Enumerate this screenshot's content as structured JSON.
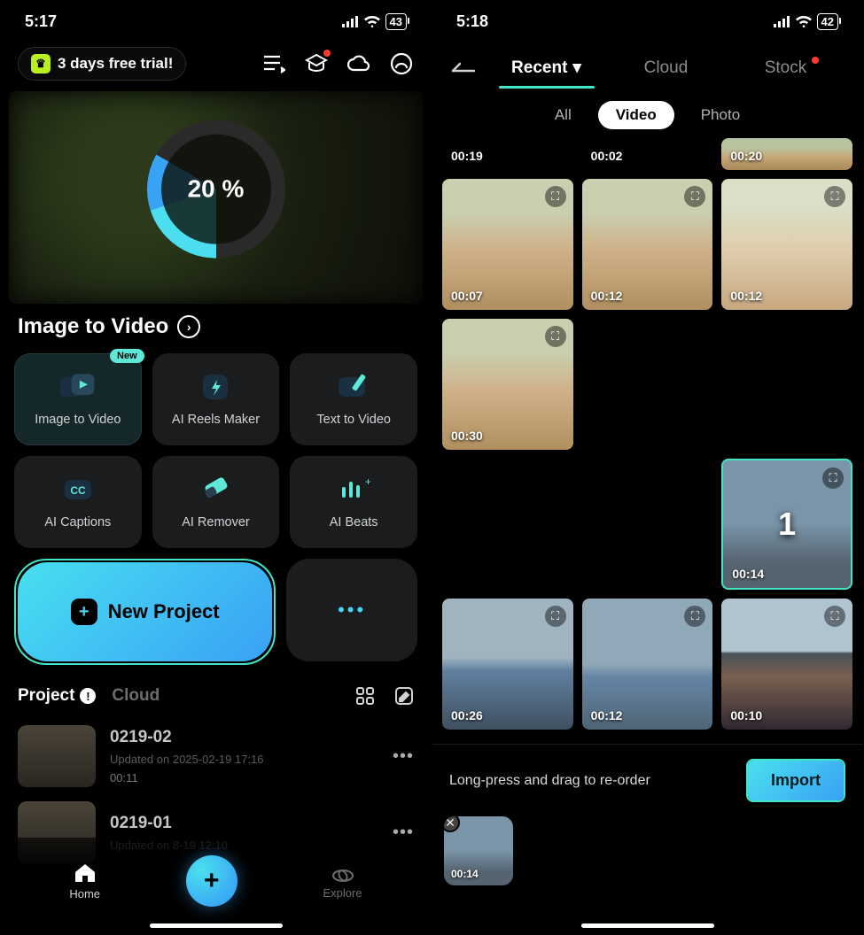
{
  "s1": {
    "status_time": "5:17",
    "battery": "43",
    "trial_text": "3 days free trial!",
    "ring_percent": "20 %",
    "feature_title": "Image to Video",
    "cards": [
      {
        "label": "Image to Video",
        "badge": "New"
      },
      {
        "label": "AI Reels Maker"
      },
      {
        "label": "Text  to Video"
      },
      {
        "label": "AI Captions"
      },
      {
        "label": "AI Remover"
      },
      {
        "label": "AI Beats"
      }
    ],
    "new_project": "New Project",
    "tabs": {
      "project": "Project",
      "cloud": "Cloud"
    },
    "projects": [
      {
        "name": "0219-02",
        "meta": "Updated on 2025-02-19 17:16",
        "dur": "00:11"
      },
      {
        "name": "0219-01",
        "meta": "Updated on            8-19 12:10",
        "dur": ""
      }
    ],
    "nav": {
      "home": "Home",
      "explore": "Explore"
    }
  },
  "s2": {
    "status_time": "5:18",
    "battery": "42",
    "tabs": {
      "recent": "Recent",
      "cloud": "Cloud",
      "stock": "Stock"
    },
    "subtabs": {
      "all": "All",
      "video": "Video",
      "photo": "Photo"
    },
    "gallery": [
      {
        "dur": "00:19",
        "cls": "blk",
        "short": true
      },
      {
        "dur": "00:02",
        "cls": "blk",
        "short": true
      },
      {
        "dur": "00:20",
        "cls": "beach1",
        "short": true
      },
      {
        "dur": "00:07",
        "cls": "beach2"
      },
      {
        "dur": "00:12",
        "cls": "beach2"
      },
      {
        "dur": "00:12",
        "cls": "beach3"
      },
      {
        "dur": "00:30",
        "cls": "beach2"
      },
      {
        "dur": "",
        "cls": "blk"
      },
      {
        "dur": "",
        "cls": "blk"
      },
      {
        "dur": "",
        "cls": "blk"
      },
      {
        "dur": "",
        "cls": "blk"
      },
      {
        "dur": "00:14",
        "cls": "skysea",
        "selected": true,
        "num": "1"
      },
      {
        "dur": "00:26",
        "cls": "skysea2"
      },
      {
        "dur": "00:12",
        "cls": "skysea3"
      },
      {
        "dur": "00:10",
        "cls": "carwin"
      }
    ],
    "import_hint": "Long-press and drag to re-order",
    "import_btn": "Import",
    "sel_dur": "00:14"
  }
}
